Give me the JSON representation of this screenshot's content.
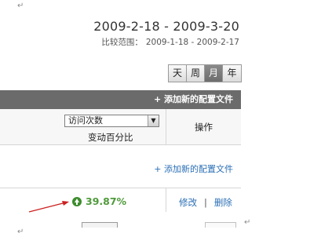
{
  "header": {
    "date_range": "2009-2-18 - 2009-3-20",
    "compare_label": "比较范围：",
    "compare_range": "2009-1-18 - 2009-2-17"
  },
  "period_buttons": [
    {
      "label": "天",
      "active": false
    },
    {
      "label": "周",
      "active": false
    },
    {
      "label": "月",
      "active": true
    },
    {
      "label": "年",
      "active": false
    }
  ],
  "panel": {
    "add_config_header": "+ 添加新的配置文件",
    "metric_select": {
      "value": "访问次数"
    },
    "change_label": "变动百分比",
    "operation_header": "操作",
    "add_config_link": "+ 添加新的配置文件",
    "row": {
      "change_percent": "39.87%",
      "edit": "修改",
      "separator": "|",
      "delete": "删除"
    }
  },
  "colors": {
    "header_bg": "#6b6b6b",
    "link": "#2b6fb5",
    "positive": "#4f9a3b",
    "annotation_arrow": "#cc1f1f"
  }
}
